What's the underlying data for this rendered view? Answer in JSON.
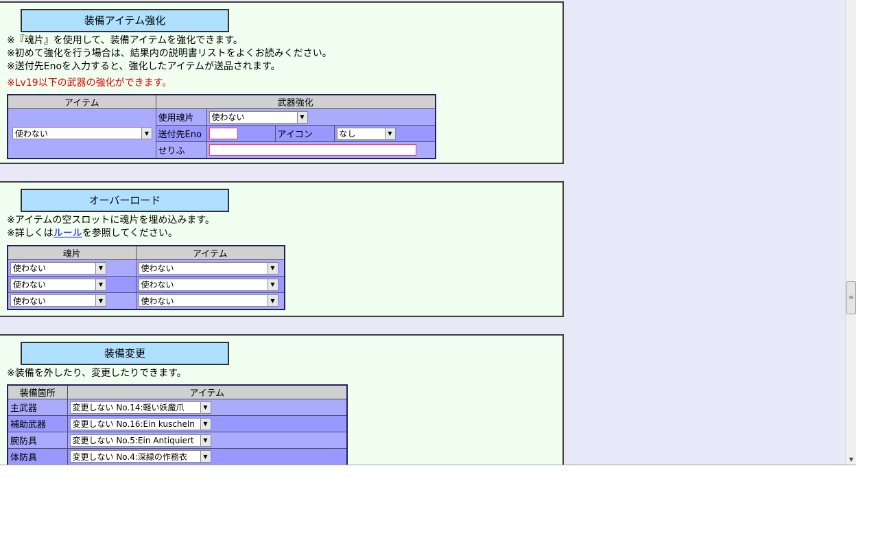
{
  "enhance": {
    "title": "装備アイテム強化",
    "notes": [
      "※『魂片』を使用して、装備アイテムを強化できます。",
      "※初めて強化を行う場合は、結果内の説明書リストをよくお読みください。",
      "※送付先Enoを入力すると、強化したアイテムが送品されます。"
    ],
    "warning_prefix": "※",
    "warning": "Lv19以下の武器の強化ができます。",
    "header_item": "アイテム",
    "header_weapon": "武器強化",
    "item_select": "使わない",
    "label_soul": "使用魂片",
    "soul_select": "使わない",
    "label_eno": "送付先Eno",
    "eno_value": "",
    "label_icon": "アイコン",
    "icon_select": "なし",
    "label_serif": "せりふ",
    "serif_value": ""
  },
  "overload": {
    "title": "オーバーロード",
    "note1": "※アイテムの空スロットに魂片を埋め込みます。",
    "note2_prefix": "※詳しくは",
    "note2_link": "ルール",
    "note2_suffix": "を参照してください。",
    "header_soul": "魂片",
    "header_item": "アイテム",
    "rows": [
      {
        "soul": "使わない",
        "item": "使わない"
      },
      {
        "soul": "使わない",
        "item": "使わない"
      },
      {
        "soul": "使わない",
        "item": "使わない"
      }
    ]
  },
  "equip": {
    "title": "装備変更",
    "note": "※装備を外したり、変更したりできます。",
    "header_slot": "装備箇所",
    "header_item": "アイテム",
    "rows": [
      {
        "slot": "主武器",
        "item": "変更しない No.14:軽い妖魔爪"
      },
      {
        "slot": "補助武器",
        "item": "変更しない No.16:Ein kuscheln"
      },
      {
        "slot": "腕防具",
        "item": "変更しない No.5:Ein Antiquiert"
      },
      {
        "slot": "体防具",
        "item": "変更しない No.4:深緑の作務衣"
      }
    ]
  },
  "icons": {
    "dropdown": "chevron-down-icon",
    "scroll_grip": "grip-icon"
  },
  "colors": {
    "panel_bg": "#f0fff0",
    "title_bg": "#b0e0ff",
    "cell_bg": "#aaaaff",
    "header_bg": "#d0d0d0",
    "page_bg": "#e8e8f8",
    "warning": "#e00000"
  }
}
